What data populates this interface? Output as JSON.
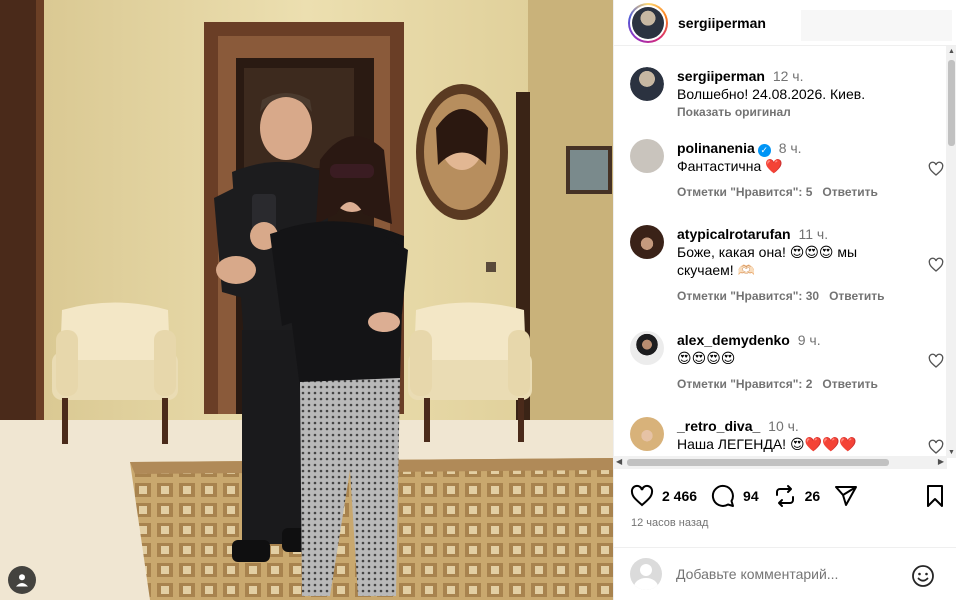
{
  "post": {
    "author": "sergiiperman",
    "caption_time": "12 ч.",
    "caption": "Волшебно! 24.08.2026. Киев.",
    "show_original": "Показать оригинал",
    "likes": "2 466",
    "comments_count": "94",
    "reposts": "26",
    "posted_ago": "12 часов назад"
  },
  "comments": [
    {
      "user": "polinanenia",
      "verified": true,
      "verified_mark": "✓",
      "time": "8 ч.",
      "text": "Фантастична ❤️",
      "likes_label": "Отметки \"Нравится\": 5",
      "reply": "Ответить",
      "avatar_color": "#c9c4bd"
    },
    {
      "user": "atypicalrotarufan",
      "verified": false,
      "time": "11 ч.",
      "text": "Боже, какая она! 😍😍😍 мы скучаем! 🫶🏻",
      "likes_label": "Отметки \"Нравится\": 30",
      "reply": "Ответить",
      "avatar_color": "#3a2218"
    },
    {
      "user": "alex_demydenko",
      "verified": false,
      "time": "9 ч.",
      "text": "😍😍😍😍",
      "likes_label": "Отметки \"Нравится\": 2",
      "reply": "Ответить",
      "avatar_color": "#e9e9e9"
    },
    {
      "user": "_retro_diva_",
      "verified": false,
      "time": "10 ч.",
      "text": "Наша ЛЕГЕНДА! 😍❤️❤️❤️",
      "likes_label": "",
      "reply": "",
      "avatar_color": "#d8b27a"
    }
  ],
  "add_comment": {
    "placeholder": "Добавьте комментарий..."
  },
  "icons": {
    "like": "heart-icon",
    "comment": "comment-icon",
    "repost": "repost-icon",
    "share": "send-icon",
    "save": "bookmark-icon",
    "emoji": "emoji-icon",
    "tag": "user-tag-icon"
  },
  "scroll": {
    "up": "▲",
    "down": "▼",
    "left": "◀",
    "right": "▶"
  },
  "colors": {
    "link_muted": "#737373",
    "verified": "#0095f6",
    "like_red": "#ff3040"
  }
}
